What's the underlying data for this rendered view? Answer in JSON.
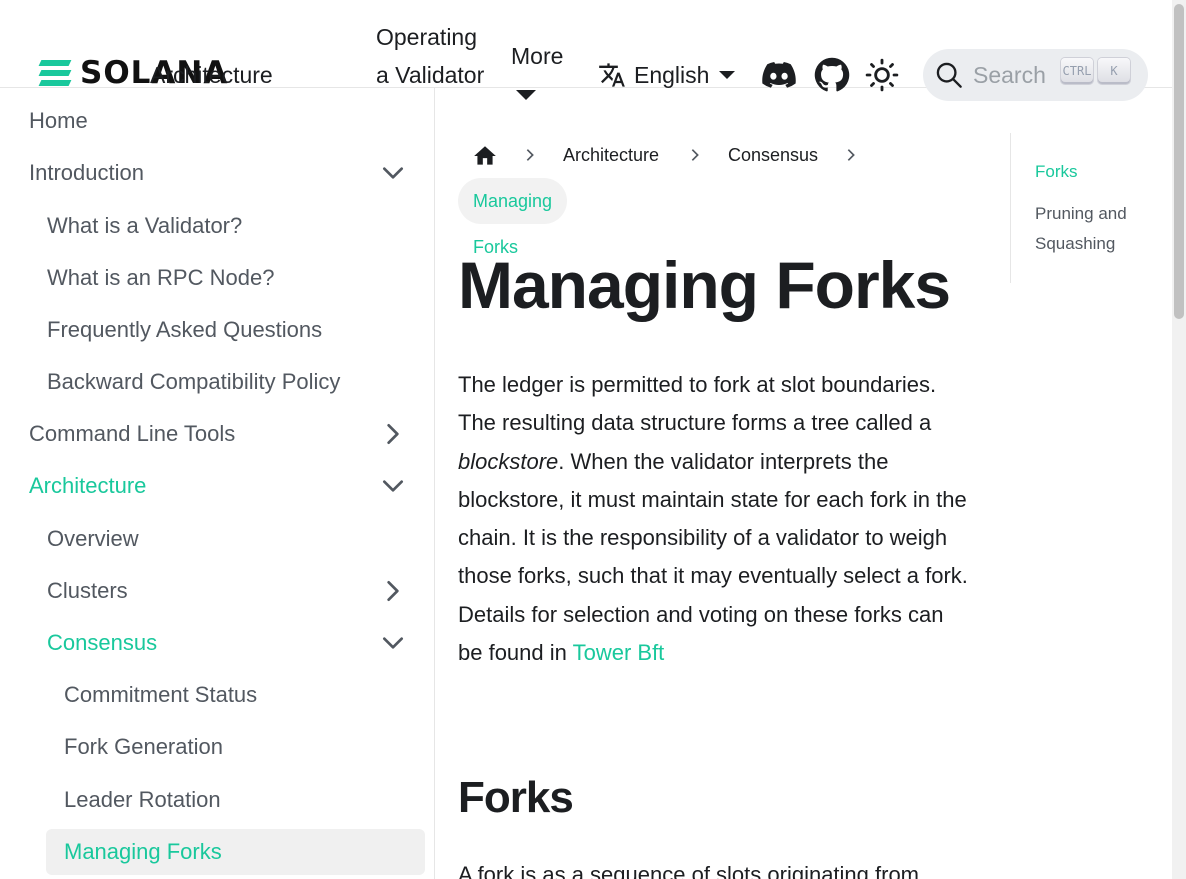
{
  "navbar": {
    "logo_text": "SOLANA",
    "links": [
      "Architecture",
      "Operating a Validator",
      "More"
    ],
    "language": "English",
    "search_placeholder": "Search",
    "kbd_ctrl": "CTRL",
    "kbd_k": "K"
  },
  "sidebar": {
    "home": "Home",
    "introduction": "Introduction",
    "intro_items": [
      "What is a Validator?",
      "What is an RPC Node?",
      "Frequently Asked Questions",
      "Backward Compatibility Policy"
    ],
    "cli": "Command Line Tools",
    "architecture": "Architecture",
    "arch_items": [
      "Overview",
      "Clusters",
      "Consensus"
    ],
    "consensus_items": [
      "Commitment Status",
      "Fork Generation",
      "Leader Rotation",
      "Managing Forks"
    ]
  },
  "breadcrumbs": {
    "items": [
      "Architecture",
      "Consensus"
    ],
    "current": "Managing Forks"
  },
  "content": {
    "title": "Managing Forks",
    "p1_a": "The ledger is permitted to fork at slot boundaries. The resulting data structure forms a tree called a ",
    "p1_em": "blockstore",
    "p1_b": ". When the validator interprets the blockstore, it must maintain state for each fork in the chain. It is the responsibility of a validator to weigh those forks, such that it may eventually select a fork. Details for selection and voting on these forks can be found in ",
    "p1_link": "Tower Bft",
    "h2": "Forks",
    "p2": "A fork is as a sequence of slots originating from"
  },
  "toc": {
    "items": [
      "Forks",
      "Pruning and Squashing"
    ]
  },
  "colors": {
    "accent": "#19c89c",
    "text": "#1c1e21",
    "muted": "#525860"
  }
}
